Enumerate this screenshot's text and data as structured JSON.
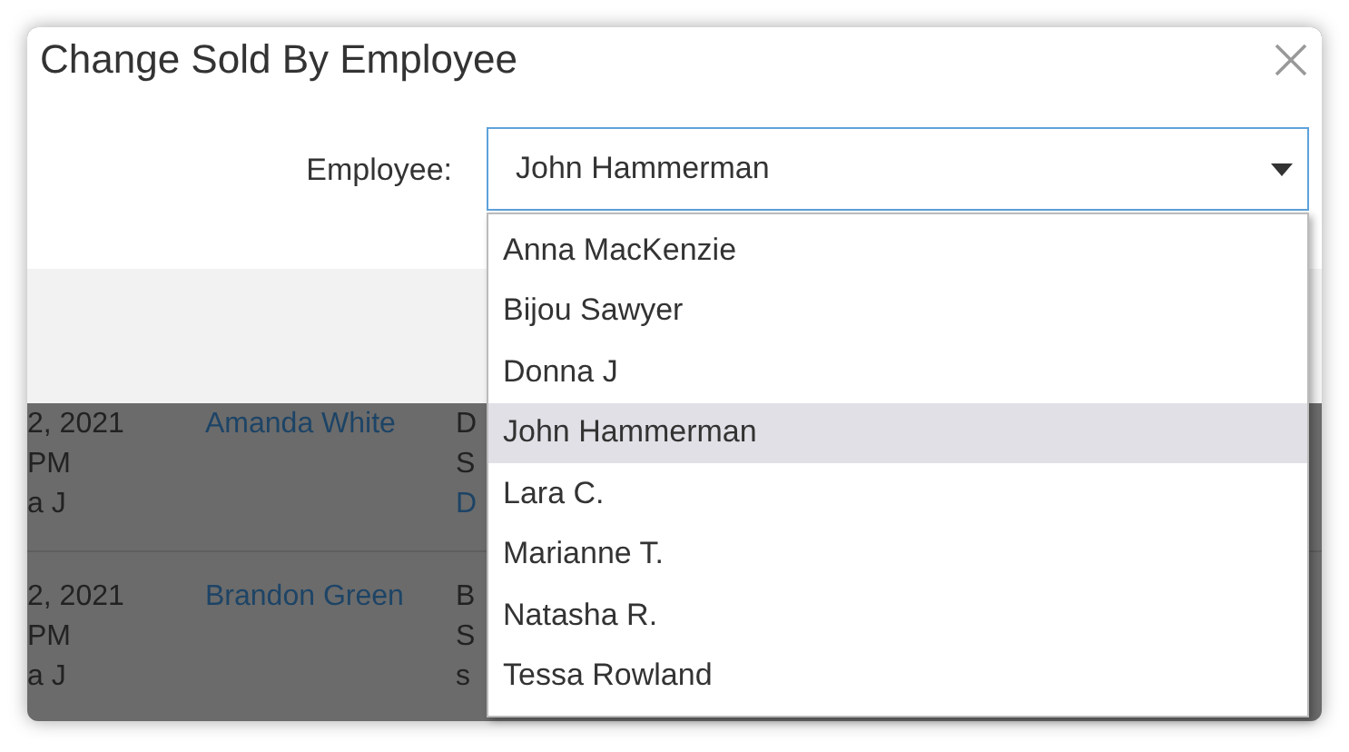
{
  "dialog": {
    "title": "Change Sold By Employee",
    "field": {
      "label": "Employee:",
      "value": "John Hammerman"
    },
    "options": [
      {
        "label": "Anna MacKenzie",
        "selected": false
      },
      {
        "label": "Bijou Sawyer",
        "selected": false
      },
      {
        "label": "Donna J",
        "selected": false
      },
      {
        "label": "John Hammerman",
        "selected": true
      },
      {
        "label": "Lara C.",
        "selected": false
      },
      {
        "label": "Marianne T.",
        "selected": false
      },
      {
        "label": "Natasha R.",
        "selected": false
      },
      {
        "label": "Tessa Rowland",
        "selected": false
      }
    ]
  },
  "background_table": {
    "rows": [
      {
        "column_1": [
          "2, 2021",
          "PM",
          "a J"
        ],
        "column_2": "Amanda White",
        "column_3": [
          {
            "text": "D",
            "kind": "text"
          },
          {
            "text": "S",
            "kind": "text"
          },
          {
            "text": "D",
            "kind": "link"
          }
        ]
      },
      {
        "column_1": [
          "2, 2021",
          "PM",
          "a J"
        ],
        "column_2": "Brandon Green",
        "column_3": [
          {
            "text": "B",
            "kind": "text"
          },
          {
            "text": "S",
            "kind": "text"
          },
          {
            "text": "s",
            "kind": "text"
          }
        ]
      }
    ]
  }
}
